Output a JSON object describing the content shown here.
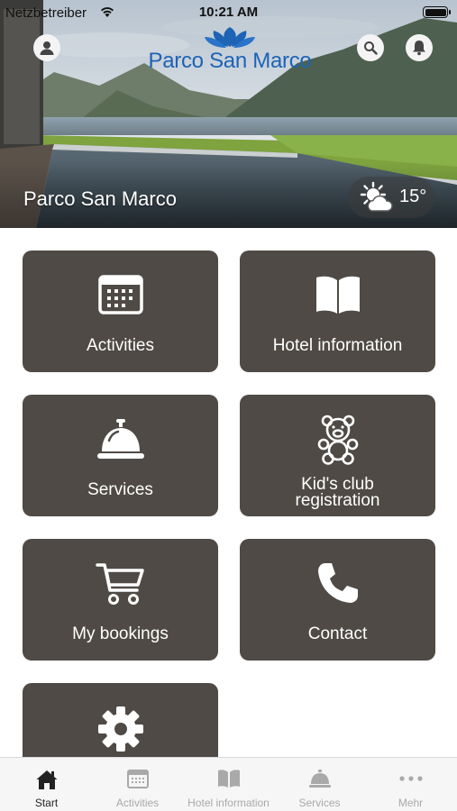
{
  "status_bar": {
    "carrier": "Netzbetreiber",
    "time": "10:21 AM"
  },
  "header": {
    "logo_text": "Parco San Marco",
    "place_name": "Parco San Marco",
    "temperature": "15°",
    "weather_icon": "sun-cloud-icon",
    "profile_icon": "user-icon",
    "search_icon": "search-icon",
    "notifications_icon": "bell-icon"
  },
  "tiles": [
    {
      "label": "Activities",
      "icon": "calendar-icon"
    },
    {
      "label": "Hotel information",
      "icon": "book-icon"
    },
    {
      "label": "Services",
      "icon": "service-bell-icon"
    },
    {
      "label": "Kid's club registration",
      "label_line1": "Kid's club",
      "label_line2": "registration",
      "icon": "teddy-bear-icon"
    },
    {
      "label": "My bookings",
      "icon": "cart-icon"
    },
    {
      "label": "Contact",
      "icon": "phone-icon"
    },
    {
      "label": "",
      "icon": "gear-icon"
    }
  ],
  "tabbar": {
    "items": [
      {
        "label": "Start",
        "icon": "home-icon",
        "active": true
      },
      {
        "label": "Activities",
        "icon": "calendar-icon",
        "active": false
      },
      {
        "label": "Hotel information",
        "icon": "book-icon",
        "active": false
      },
      {
        "label": "Services",
        "icon": "service-bell-icon",
        "active": false
      },
      {
        "label": "Mehr",
        "icon": "more-icon",
        "active": false
      }
    ]
  },
  "colors": {
    "tile_bg": "#4f4a45",
    "brand_blue": "#1d63b6",
    "tab_active": "#222222",
    "tab_inactive": "#a9a9a9"
  }
}
